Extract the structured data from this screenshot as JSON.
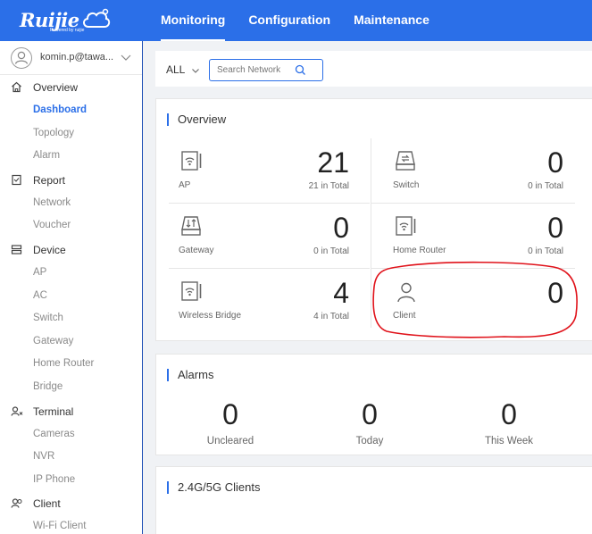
{
  "brand": {
    "name": "Ruijie",
    "tagline": "Powered by ruijie"
  },
  "nav": {
    "items": [
      {
        "label": "Monitoring",
        "active": true
      },
      {
        "label": "Configuration",
        "active": false
      },
      {
        "label": "Maintenance",
        "active": false
      }
    ]
  },
  "user": {
    "name": "komin.p@tawa..."
  },
  "sidebar": {
    "groups": [
      {
        "label": "Overview",
        "icon": "home-icon",
        "items": [
          "Dashboard",
          "Topology",
          "Alarm"
        ]
      },
      {
        "label": "Report",
        "icon": "report-icon",
        "items": [
          "Network",
          "Voucher"
        ]
      },
      {
        "label": "Device",
        "icon": "device-icon",
        "items": [
          "AP",
          "AC",
          "Switch",
          "Gateway",
          "Home Router",
          "Bridge"
        ]
      },
      {
        "label": "Terminal",
        "icon": "terminal-icon",
        "items": [
          "Cameras",
          "NVR",
          "IP Phone"
        ]
      },
      {
        "label": "Client",
        "icon": "client-icon",
        "items": [
          "Wi-Fi Client"
        ]
      }
    ],
    "active_item": "Dashboard"
  },
  "search": {
    "scope": "ALL",
    "placeholder": "Search Network"
  },
  "overview": {
    "title": "Overview",
    "cells": [
      {
        "label": "AP",
        "count": "21",
        "total": "21 in Total",
        "icon": "ap-icon"
      },
      {
        "label": "Switch",
        "count": "0",
        "total": "0 in Total",
        "icon": "switch-icon"
      },
      {
        "label": "Gateway",
        "count": "0",
        "total": "0 in Total",
        "icon": "gateway-icon"
      },
      {
        "label": "Home Router",
        "count": "0",
        "total": "0 in Total",
        "icon": "home-router-icon"
      },
      {
        "label": "Wireless Bridge",
        "count": "4",
        "total": "4 in Total",
        "icon": "wireless-bridge-icon"
      },
      {
        "label": "Client",
        "count": "0",
        "total": "",
        "icon": "client-icon"
      }
    ]
  },
  "alarms": {
    "title": "Alarms",
    "items": [
      {
        "label": "Uncleared",
        "count": "0"
      },
      {
        "label": "Today",
        "count": "0"
      },
      {
        "label": "This Week",
        "count": "0"
      }
    ]
  },
  "clients": {
    "title": "2.4G/5G Clients"
  },
  "colors": {
    "primary": "#2b6fe8",
    "annotation": "#e0121a"
  }
}
